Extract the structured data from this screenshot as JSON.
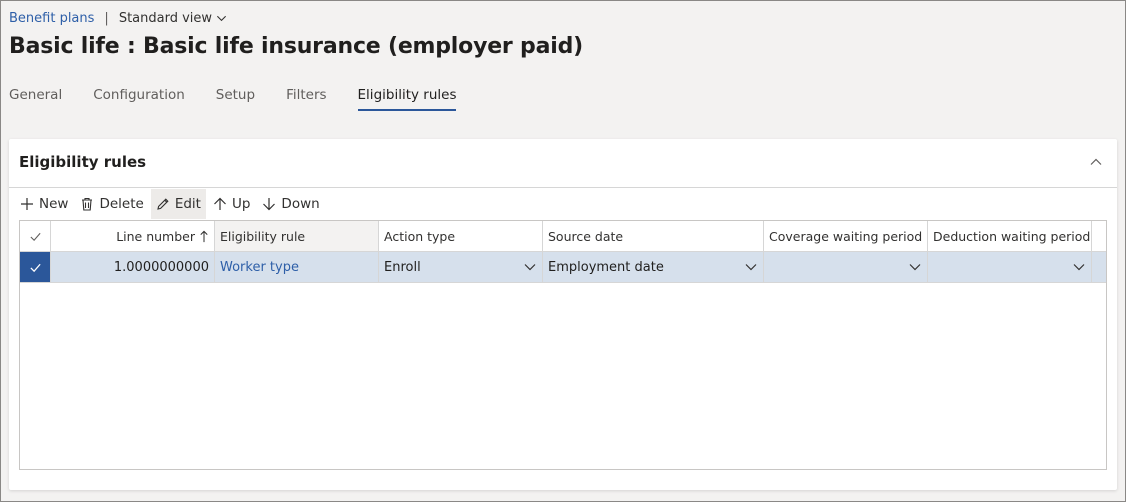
{
  "breadcrumb": {
    "link": "Benefit plans",
    "separator": "|",
    "view": "Standard view"
  },
  "page_title": "Basic life : Basic life insurance (employer paid)",
  "tabs": [
    {
      "label": "General",
      "active": false
    },
    {
      "label": "Configuration",
      "active": false
    },
    {
      "label": "Setup",
      "active": false
    },
    {
      "label": "Filters",
      "active": false
    },
    {
      "label": "Eligibility rules",
      "active": true
    }
  ],
  "section": {
    "title": "Eligibility rules"
  },
  "toolbar": {
    "new_label": "New",
    "delete_label": "Delete",
    "edit_label": "Edit",
    "up_label": "Up",
    "down_label": "Down"
  },
  "grid": {
    "columns": {
      "line_number": "Line number",
      "eligibility_rule": "Eligibility rule",
      "action_type": "Action type",
      "source_date": "Source date",
      "coverage_waiting_period": "Coverage waiting period",
      "deduction_waiting_period": "Deduction waiting period"
    },
    "rows": [
      {
        "line_number": "1.0000000000",
        "eligibility_rule": "Worker type",
        "action_type": "Enroll",
        "source_date": "Employment date",
        "coverage_waiting_period": "",
        "deduction_waiting_period": ""
      }
    ]
  },
  "colors": {
    "accent": "#2b579a",
    "link": "#2e5fa8",
    "selected_row": "#d6e0ec"
  },
  "icons": {
    "new": "plus-icon",
    "delete": "trash-icon",
    "edit": "pencil-icon",
    "up": "arrow-up-icon",
    "down": "arrow-down-icon",
    "collapse": "chevron-up-icon",
    "dropdown": "chevron-down-icon",
    "check": "checkmark-icon",
    "sort": "sort-ascending-icon"
  }
}
